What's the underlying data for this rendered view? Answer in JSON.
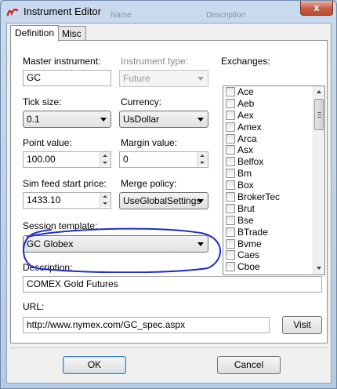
{
  "window": {
    "title": "Instrument Editor",
    "close_glyph": "x"
  },
  "ghost_headers": [
    "Name",
    "Description"
  ],
  "tabs": [
    {
      "label": "Definition",
      "active": true
    },
    {
      "label": "Misc",
      "active": false
    }
  ],
  "fields": {
    "master_instrument": {
      "label": "Master instrument:",
      "value": "GC"
    },
    "instrument_type": {
      "label": "Instrument type:",
      "value": "Future"
    },
    "tick_size": {
      "label": "Tick size:",
      "value": "0.1"
    },
    "currency": {
      "label": "Currency:",
      "value": "UsDollar"
    },
    "point_value": {
      "label": "Point value:",
      "value": "100.00"
    },
    "margin_value": {
      "label": "Margin value:",
      "value": "0"
    },
    "sim_feed_start_price": {
      "label": "Sim feed start price:",
      "value": "1433.10"
    },
    "merge_policy": {
      "label": "Merge policy:",
      "value": "UseGlobalSettings"
    },
    "session_template": {
      "label": "Session template:",
      "value": "GC Globex"
    },
    "description": {
      "label": "Description:",
      "value": "COMEX Gold Futures"
    },
    "url": {
      "label": "URL:",
      "value": "http://www.nymex.com/GC_spec.aspx"
    }
  },
  "exchanges": {
    "label": "Exchanges:",
    "items": [
      "Ace",
      "Aeb",
      "Aex",
      "Amex",
      "Arca",
      "Asx",
      "Belfox",
      "Bm",
      "Box",
      "BrokerTec",
      "Brut",
      "Bse",
      "BTrade",
      "Bvme",
      "Caes",
      "Cboe"
    ]
  },
  "buttons": {
    "visit": "Visit",
    "ok": "OK",
    "cancel": "Cancel"
  },
  "colors": {
    "annotation": "#1f2ec4",
    "close_button": "#c65c45",
    "titlebar": "#c9daee"
  },
  "icons": {
    "app": "ninja-logo-icon"
  }
}
